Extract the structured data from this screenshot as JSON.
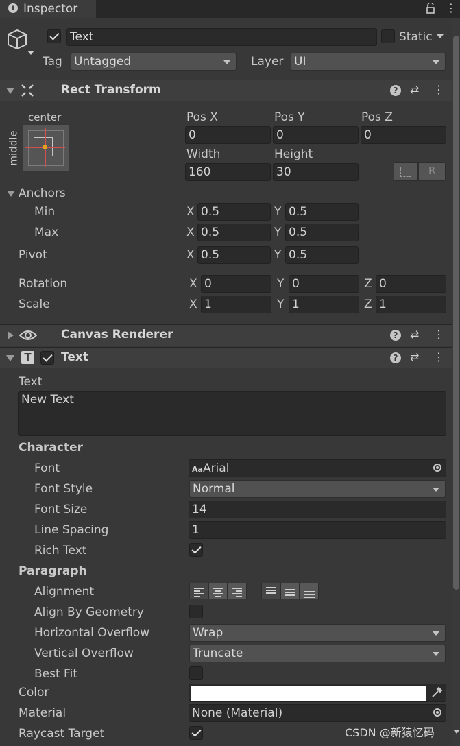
{
  "tab": {
    "title": "Inspector"
  },
  "object": {
    "active": true,
    "name": "Text",
    "static_label": "Static",
    "tag_label": "Tag",
    "tag_value": "Untagged",
    "layer_label": "Layer",
    "layer_value": "UI"
  },
  "rect": {
    "title": "Rect Transform",
    "anchor_h": "center",
    "anchor_v": "middle",
    "posx_label": "Pos X",
    "posy_label": "Pos Y",
    "posz_label": "Pos Z",
    "posx": "0",
    "posy": "0",
    "posz": "0",
    "width_label": "Width",
    "height_label": "Height",
    "width": "160",
    "height": "30",
    "raw_label": "R",
    "anchors_label": "Anchors",
    "min_label": "Min",
    "max_label": "Max",
    "pivot_label": "Pivot",
    "min_x": "0.5",
    "min_y": "0.5",
    "max_x": "0.5",
    "max_y": "0.5",
    "pivot_x": "0.5",
    "pivot_y": "0.5",
    "rotation_label": "Rotation",
    "scale_label": "Scale",
    "rot_x": "0",
    "rot_y": "0",
    "rot_z": "0",
    "scale_x": "1",
    "scale_y": "1",
    "scale_z": "1",
    "x": "X",
    "y": "Y",
    "z": "Z"
  },
  "canvas_renderer": {
    "title": "Canvas Renderer"
  },
  "text_comp": {
    "title": "Text",
    "enabled": true,
    "text_label": "Text",
    "text_value": "New Text",
    "character_label": "Character",
    "font_label": "Font",
    "font_prefix": "Aa",
    "font_value": "Arial",
    "font_style_label": "Font Style",
    "font_style_value": "Normal",
    "font_size_label": "Font Size",
    "font_size_value": "14",
    "line_spacing_label": "Line Spacing",
    "line_spacing_value": "1",
    "rich_text_label": "Rich Text",
    "rich_text": true,
    "paragraph_label": "Paragraph",
    "alignment_label": "Alignment",
    "align_by_geometry_label": "Align By Geometry",
    "align_by_geometry": false,
    "horizontal_overflow_label": "Horizontal Overflow",
    "horizontal_overflow_value": "Wrap",
    "vertical_overflow_label": "Vertical Overflow",
    "vertical_overflow_value": "Truncate",
    "best_fit_label": "Best Fit",
    "best_fit": false,
    "color_label": "Color",
    "color_value": "#ffffff",
    "material_label": "Material",
    "material_value": "None (Material)",
    "raycast_label": "Raycast Target",
    "raycast": true
  },
  "watermark": "CSDN @新猿忆码"
}
